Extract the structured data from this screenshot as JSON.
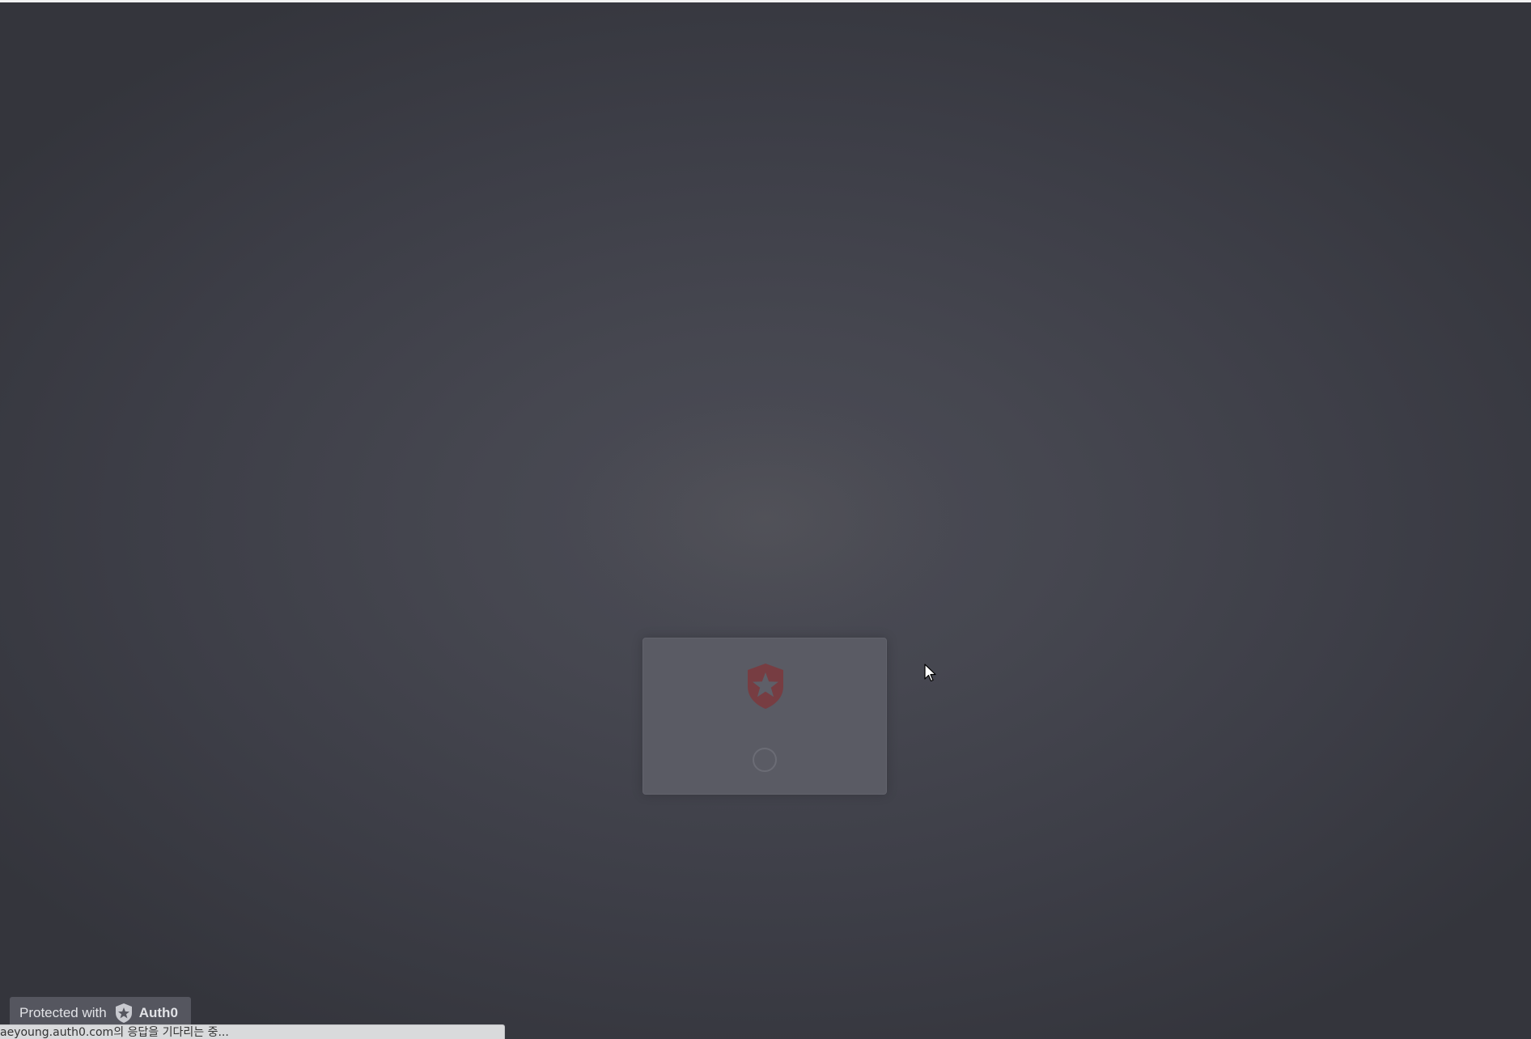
{
  "lock": {
    "logo_icon": "auth0-shield-star-icon",
    "loading_icon": "spinner-icon",
    "brand_color": "#c0392b"
  },
  "badge": {
    "protected_label": "Protected with",
    "brand_label": "Auth0",
    "icon": "auth0-badge-icon"
  },
  "statusbar": {
    "text": "aeyoung.auth0.com의 응답을 기다리는 중..."
  },
  "cursor": {
    "icon": "mouse-pointer-icon"
  }
}
